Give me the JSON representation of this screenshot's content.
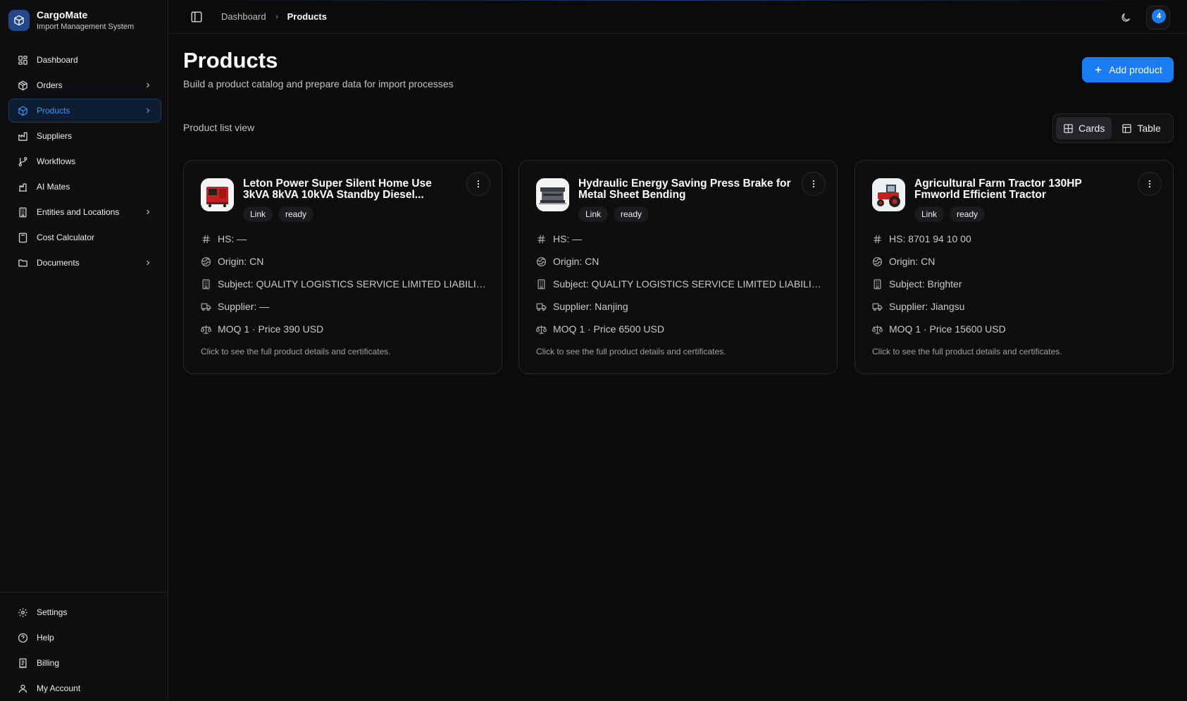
{
  "app": {
    "name": "CargoMate",
    "subtitle": "Import Management System"
  },
  "sidebar": {
    "items": [
      {
        "label": "Dashboard",
        "icon": "dashboard-icon"
      },
      {
        "label": "Orders",
        "icon": "box-icon",
        "has_children": true
      },
      {
        "label": "Products",
        "icon": "package-icon",
        "has_children": true,
        "active": true
      },
      {
        "label": "Suppliers",
        "icon": "factory-icon"
      },
      {
        "label": "Workflows",
        "icon": "git-branch-icon"
      },
      {
        "label": "AI Mates",
        "icon": "bot-icon"
      },
      {
        "label": "Entities and Locations",
        "icon": "building-icon",
        "has_children": true
      },
      {
        "label": "Cost Calculator",
        "icon": "calculator-icon"
      },
      {
        "label": "Documents",
        "icon": "folder-icon",
        "has_children": true
      }
    ],
    "bottom_items": [
      {
        "label": "Settings",
        "icon": "gear-icon"
      },
      {
        "label": "Help",
        "icon": "help-circle-icon"
      },
      {
        "label": "Billing",
        "icon": "receipt-icon"
      },
      {
        "label": "My Account",
        "icon": "user-icon"
      }
    ]
  },
  "topbar": {
    "breadcrumb": [
      "Dashboard",
      "Products"
    ],
    "notifications_count": "4"
  },
  "page": {
    "title": "Products",
    "subtitle": "Build a product catalog and prepare data for import processes",
    "add_button": "Add product",
    "list_label": "Product list view",
    "view_toggle": {
      "cards": "Cards",
      "table": "Table",
      "selected": "Cards"
    }
  },
  "products": [
    {
      "title": "Leton Power Super Silent Home Use 3kVA 8kVA 10kVA Standby Diesel...",
      "tags": [
        "Link",
        "ready"
      ],
      "hs": "HS: —",
      "origin": "Origin: CN",
      "subject": "Subject: QUALITY LOGISTICS SERVICE LIMITED LIABILITY ...",
      "supplier": "Supplier: —",
      "moq_price": "MOQ 1 · Price 390 USD",
      "hint": "Click to see the full product details and certificates.",
      "thumb": "generator"
    },
    {
      "title": "Hydraulic Energy Saving Press Brake for Metal Sheet Bending",
      "tags": [
        "Link",
        "ready"
      ],
      "hs": "HS: —",
      "origin": "Origin: CN",
      "subject": "Subject: QUALITY LOGISTICS SERVICE LIMITED LIABILITY ...",
      "supplier": "Supplier: Nanjing",
      "moq_price": "MOQ 1 · Price 6500 USD",
      "hint": "Click to see the full product details and certificates.",
      "thumb": "press-brake"
    },
    {
      "title": "Agricultural Farm Tractor 130HP Fmworld Efficient Tractor",
      "tags": [
        "Link",
        "ready"
      ],
      "hs": "HS: 8701 94 10 00",
      "origin": "Origin: CN",
      "subject": "Subject: Brighter",
      "supplier": "Supplier: Jiangsu",
      "moq_price": "MOQ 1 · Price 15600 USD",
      "hint": "Click to see the full product details and certificates.",
      "thumb": "tractor"
    }
  ],
  "colors": {
    "accent": "#1a7cf2",
    "active_nav": "#3d92ff",
    "background": "#0b0b0c"
  }
}
